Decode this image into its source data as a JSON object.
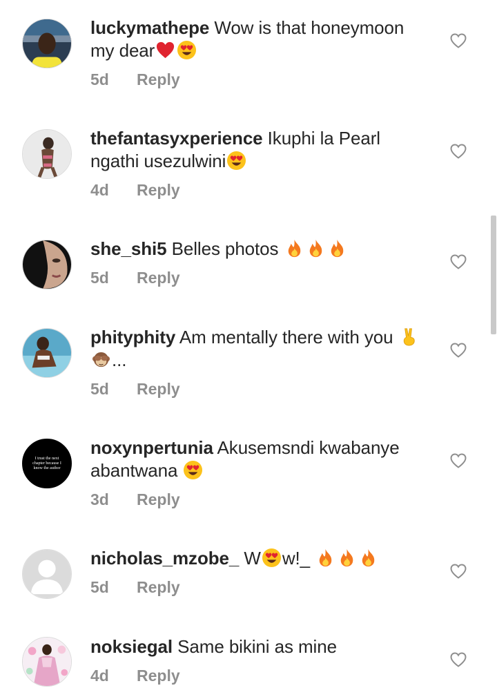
{
  "comments": [
    {
      "username": "luckymathepe",
      "text": "Wow is that honeymoon my dear",
      "time": "5d",
      "reply_label": "Reply",
      "emojis": [
        "red-heart",
        "heart-eyes"
      ],
      "avatar": "man-yellow-shirt-photo"
    },
    {
      "username": "thefantasyxperience",
      "text": "Ikuphi la Pearl ngathi usezulwini",
      "time": "4d",
      "reply_label": "Reply",
      "emojis": [
        "heart-eyes"
      ],
      "avatar": "woman-beach-photo"
    },
    {
      "username": "she_shi5",
      "text": "Belles photos",
      "time": "5d",
      "reply_label": "Reply",
      "emojis": [
        "fire",
        "fire",
        "fire"
      ],
      "avatar": "face-closeup-photo"
    },
    {
      "username": "phityphity",
      "text": "Am mentally there with you",
      "text_suffix": "...",
      "time": "5d",
      "reply_label": "Reply",
      "emojis": [
        "victory-hand",
        "see-no-evil-monkey"
      ],
      "avatar": "woman-pool-photo"
    },
    {
      "username": "noxynpertunia",
      "text": "Akusemsndi kwabanye abantwana",
      "time": "3d",
      "reply_label": "Reply",
      "emojis": [
        "heart-eyes"
      ],
      "avatar": "quote-text-avatar",
      "avatar_text": "I trust the next chapter because I know the author"
    },
    {
      "username": "nicholas_mzobe_",
      "text_parts": [
        "W",
        "w!_"
      ],
      "time": "5d",
      "reply_label": "Reply",
      "emojis": [
        "heart-eyes",
        "fire",
        "fire",
        "fire"
      ],
      "avatar": "default-avatar"
    },
    {
      "username": "noksiegal",
      "text": "Same bikini as mine",
      "time": "4d",
      "reply_label": "Reply",
      "emojis": [],
      "avatar": "woman-flowers-photo"
    }
  ],
  "icons": {
    "like": "heart-outline-icon"
  },
  "colors": {
    "text": "#262626",
    "meta": "#8e8e8e",
    "heart_outline": "#8e8e8e",
    "scrollbar": "#c9c9c9"
  }
}
